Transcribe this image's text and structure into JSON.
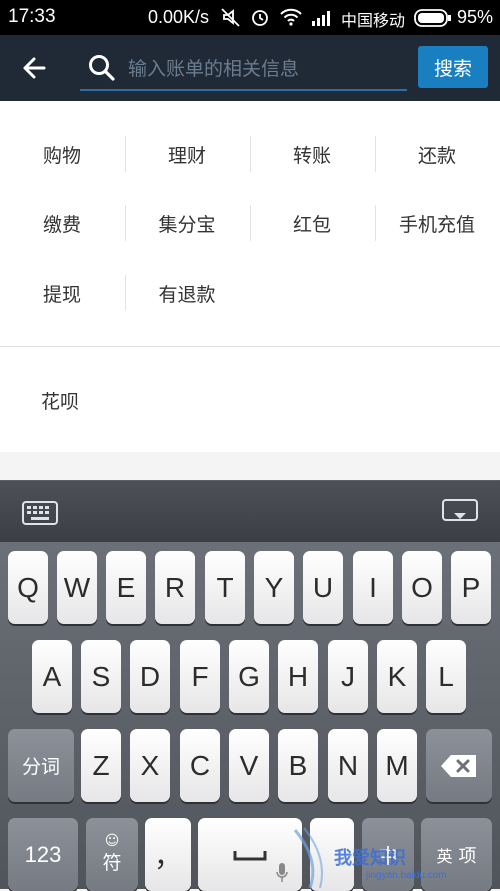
{
  "status_bar": {
    "time": "17:33",
    "network_speed": "0.00K/s",
    "carrier": "中国移动",
    "battery_percent": "95%"
  },
  "header": {
    "search_placeholder": "输入账单的相关信息",
    "search_button": "搜索"
  },
  "categories": {
    "rows": [
      [
        "购物",
        "理财",
        "转账",
        "还款"
      ],
      [
        "缴费",
        "集分宝",
        "红包",
        "手机充值"
      ],
      [
        "提现",
        "有退款"
      ]
    ],
    "extra_item": "花呗"
  },
  "keyboard": {
    "row1": [
      "Q",
      "W",
      "E",
      "R",
      "T",
      "Y",
      "U",
      "I",
      "O",
      "P"
    ],
    "row2": [
      "A",
      "S",
      "D",
      "F",
      "G",
      "H",
      "J",
      "K",
      "L"
    ],
    "row3": [
      "Z",
      "X",
      "C",
      "V",
      "B",
      "N",
      "M"
    ],
    "segment_key": "分词",
    "num_key": "123",
    "symbol_key": "符",
    "comma_key": "，",
    "lang_key": "中",
    "lang_key2": "英",
    "right_key": "项"
  },
  "watermark": {
    "text": "我爱知识",
    "url": "jingyan.baidu.com"
  },
  "colors": {
    "header_bg": "#1f2a36",
    "search_button": "#1a7fc1",
    "accent_line": "#2f6fa0"
  }
}
